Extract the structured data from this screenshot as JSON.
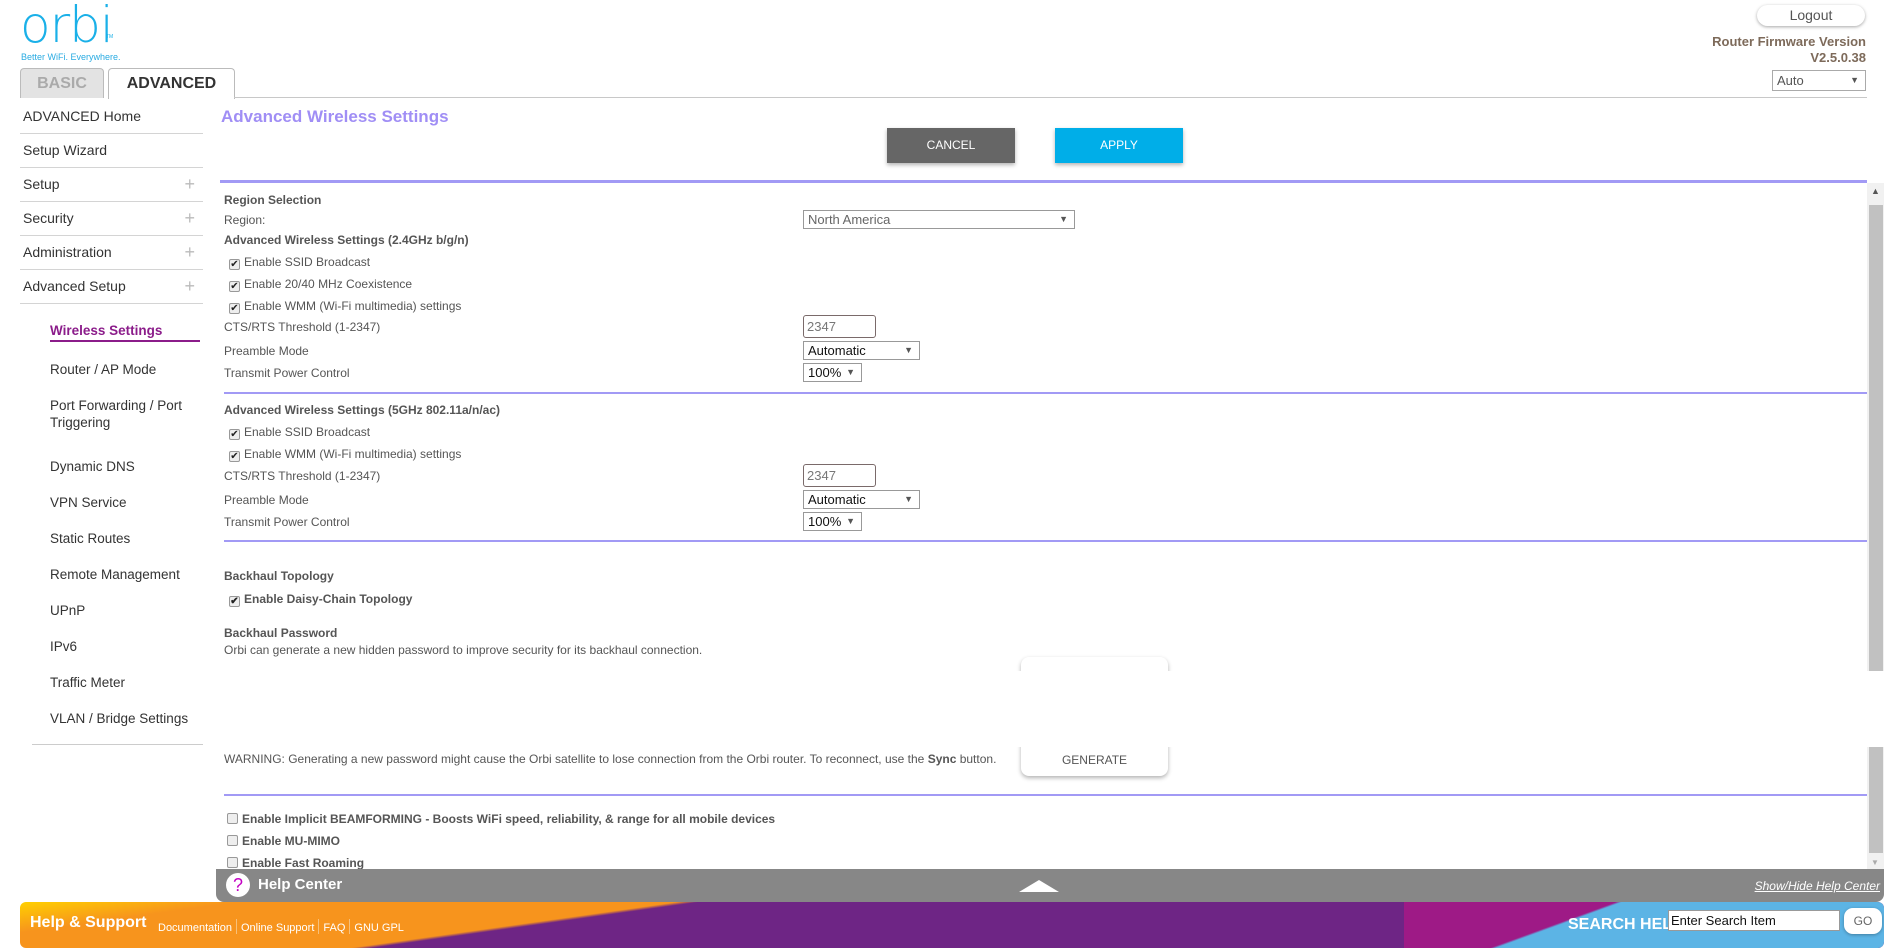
{
  "header": {
    "logo": "orbi",
    "tm": "TM",
    "tagline": "Better WiFi. Everywhere.",
    "logout": "Logout",
    "fw_label": "Router Firmware Version",
    "fw_version": "V2.5.0.38",
    "lang": "Auto"
  },
  "tabs": {
    "basic": "BASIC",
    "advanced": "ADVANCED"
  },
  "nav": {
    "items": [
      "ADVANCED Home",
      "Setup Wizard",
      "Setup",
      "Security",
      "Administration",
      "Advanced Setup"
    ],
    "sub": [
      "Wireless Settings",
      "Router / AP Mode",
      "Port Forwarding / Port Triggering",
      "Dynamic DNS",
      "VPN Service",
      "Static Routes",
      "Remote Management",
      "UPnP",
      "IPv6",
      "Traffic Meter",
      "VLAN / Bridge Settings"
    ]
  },
  "main": {
    "title": "Advanced Wireless Settings",
    "cancel": "CANCEL",
    "apply": "APPLY",
    "region_heading": "Region Selection",
    "region_label": "Region:",
    "region_value": "North America",
    "g24": {
      "heading": "Advanced Wireless Settings (2.4GHz b/g/n)",
      "ssid": "Enable SSID Broadcast",
      "coex": "Enable 20/40 MHz Coexistence",
      "wmm": "Enable WMM (Wi-Fi multimedia) settings",
      "cts_label": "CTS/RTS Threshold (1-2347)",
      "cts": "2347",
      "preamble_label": "Preamble Mode",
      "preamble": "Automatic",
      "tpc_label": "Transmit Power Control",
      "tpc": "100%"
    },
    "g5": {
      "heading": "Advanced Wireless Settings (5GHz 802.11a/n/ac)",
      "ssid": "Enable SSID Broadcast",
      "wmm": "Enable WMM (Wi-Fi multimedia) settings",
      "cts_label": "CTS/RTS Threshold (1-2347)",
      "cts": "2347",
      "preamble_label": "Preamble Mode",
      "preamble": "Automatic",
      "tpc_label": "Transmit Power Control",
      "tpc": "100%"
    },
    "backhaul": {
      "topo_heading": "Backhaul Topology",
      "daisy": "Enable Daisy-Chain Topology",
      "pw_heading": "Backhaul Password",
      "pw_desc": "Orbi can generate a new hidden password to improve security for its backhaul connection.",
      "warning_pre": "WARNING: Generating a new password might cause the Orbi satellite to lose connection from the Orbi router. To reconnect, use the ",
      "warning_bold": "Sync",
      "warning_post": " button.",
      "generate": "GENERATE"
    },
    "beamforming": "Enable Implicit BEAMFORMING - Boosts WiFi speed, reliability, & range for all mobile devices",
    "mumimo": "Enable MU-MIMO",
    "fastroam": "Enable Fast Roaming"
  },
  "help": {
    "title": "Help Center",
    "toggle": "Show/Hide Help Center"
  },
  "footer": {
    "title": "Help & Support",
    "links": [
      "Documentation",
      "Online Support",
      "FAQ",
      "GNU GPL"
    ],
    "search_label": "SEARCH HELP",
    "search_value": "Enter Search Item",
    "go": "GO"
  }
}
